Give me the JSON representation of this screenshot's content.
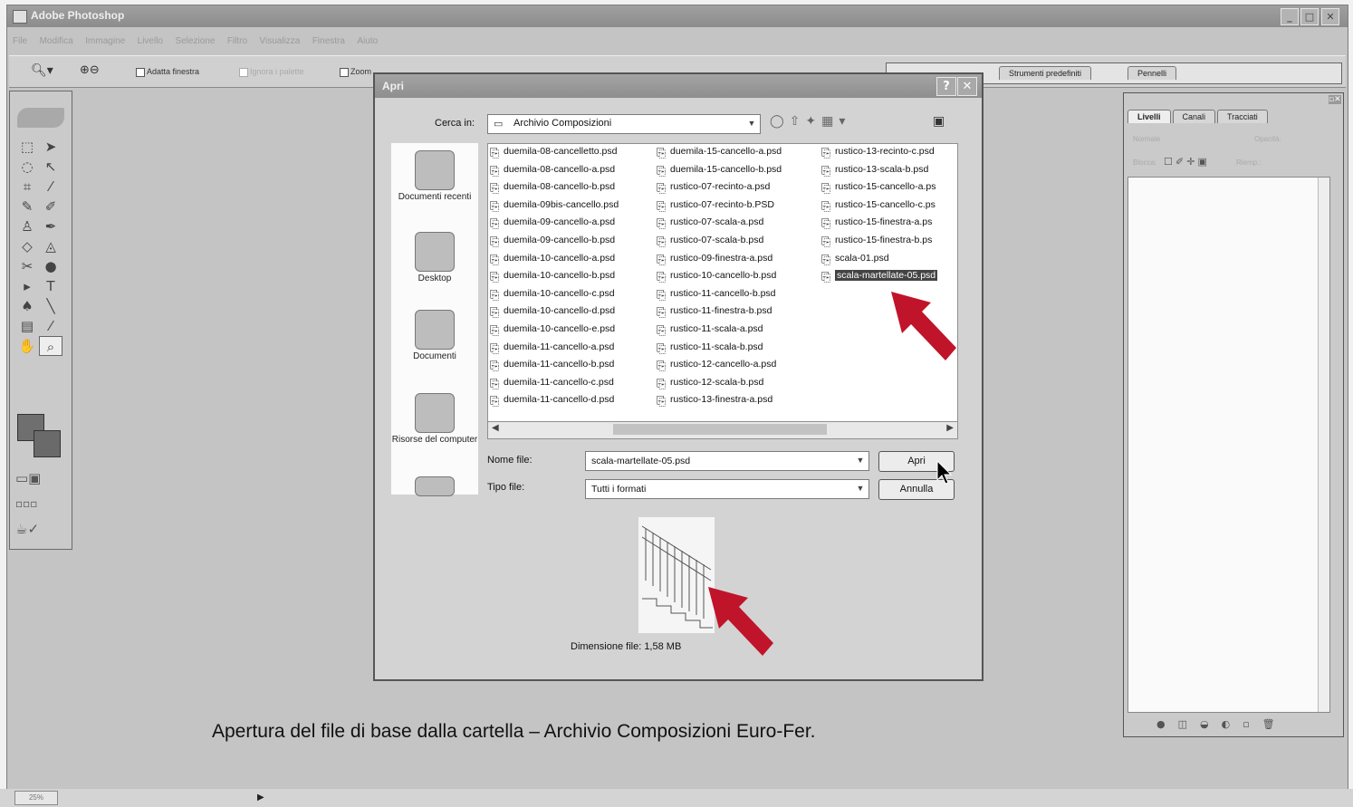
{
  "app": {
    "title": "Adobe Photoshop",
    "menu": [
      "File",
      "Modifica",
      "Immagine",
      "Livello",
      "Selezione",
      "Filtro",
      "Visualizza",
      "Finestra",
      "Aiuto"
    ],
    "options": {
      "fit_window": "Adatta finestra",
      "ignore_palettes": "Ignora i palette",
      "zoom_all": "Zoom",
      "tabs": [
        "Strumenti predefiniti",
        "Pennelli"
      ]
    },
    "window_buttons": [
      "_",
      "□",
      "✕"
    ]
  },
  "layers_panel": {
    "tabs": [
      "Livelli",
      "Canali",
      "Tracciati"
    ],
    "blend_mode": "Normale",
    "opacity_label": "Opacità:",
    "lock_label": "Blocca:",
    "fill_label": "Riemp.:"
  },
  "dialog": {
    "title": "Apri",
    "help_button": "?",
    "close_button": "✕",
    "look_in_label": "Cerca in:",
    "look_in_value": "Archivio Composizioni",
    "places": [
      {
        "label": "Documenti recenti"
      },
      {
        "label": "Desktop"
      },
      {
        "label": "Documenti"
      },
      {
        "label": "Risorse del computer"
      },
      {
        "label": ""
      }
    ],
    "files": {
      "col1": [
        "duemila-08-cancelletto.psd",
        "duemila-08-cancello-a.psd",
        "duemila-08-cancello-b.psd",
        "duemila-09bis-cancello.psd",
        "duemila-09-cancello-a.psd",
        "duemila-09-cancello-b.psd",
        "duemila-10-cancello-a.psd",
        "duemila-10-cancello-b.psd",
        "duemila-10-cancello-c.psd",
        "duemila-10-cancello-d.psd",
        "duemila-10-cancello-e.psd",
        "duemila-11-cancello-a.psd",
        "duemila-11-cancello-b.psd",
        "duemila-11-cancello-c.psd",
        "duemila-11-cancello-d.psd"
      ],
      "col2": [
        "duemila-15-cancello-a.psd",
        "duemila-15-cancello-b.psd",
        "rustico-07-recinto-a.psd",
        "rustico-07-recinto-b.PSD",
        "rustico-07-scala-a.psd",
        "rustico-07-scala-b.psd",
        "rustico-09-finestra-a.psd",
        "rustico-10-cancello-b.psd",
        "rustico-11-cancello-b.psd",
        "rustico-11-finestra-b.psd",
        "rustico-11-scala-a.psd",
        "rustico-11-scala-b.psd",
        "rustico-12-cancello-a.psd",
        "rustico-12-scala-b.psd",
        "rustico-13-finestra-a.psd"
      ],
      "col3": [
        "rustico-13-recinto-c.psd",
        "rustico-13-scala-b.psd",
        "rustico-15-cancello-a.ps",
        "rustico-15-cancello-c.ps",
        "rustico-15-finestra-a.ps",
        "rustico-15-finestra-b.ps",
        "scala-01.psd",
        "scala-martellate-05.psd"
      ]
    },
    "file_name_label": "Nome file:",
    "file_name_value": "scala-martellate-05.psd",
    "file_type_label": "Tipo file:",
    "file_type_value": "Tutti i formati",
    "open_button": "Apri",
    "cancel_button": "Annulla",
    "file_size": "Dimensione file: 1,58 MB"
  },
  "caption": "Apertura del file di base dalla cartella – Archivio Composizioni Euro-Fer.",
  "status": {
    "zoom": "25%"
  },
  "colors": {
    "arrow": "#c0142a",
    "selection": "#444444"
  }
}
